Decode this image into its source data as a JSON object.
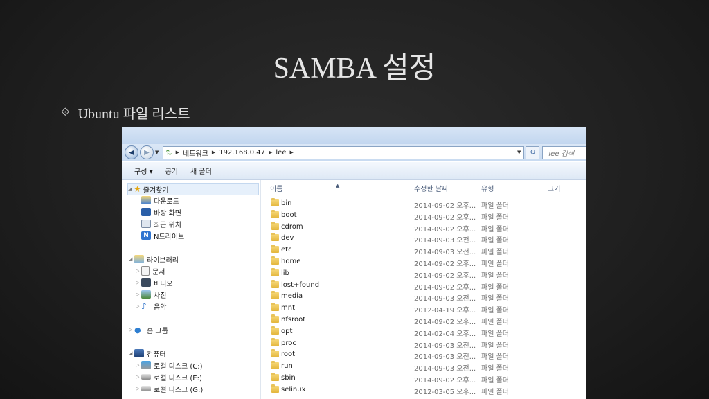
{
  "slide": {
    "title": "SAMBA 설정",
    "bullet_glyph": "⟐",
    "bullet_text": "Ubuntu 파일 리스트"
  },
  "explorer": {
    "address": {
      "crumbs": [
        "네트워크",
        "192.168.0.47",
        "lee"
      ],
      "search_placeholder": "lee 검색"
    },
    "toolbar": {
      "organize": "구성 ▾",
      "share": "공기",
      "new_folder": "새 폴더"
    },
    "nav_pane": {
      "favorites": {
        "label": "즐겨찾기",
        "items": [
          "다운로드",
          "바탕 화면",
          "최근 위치",
          "N드라이브"
        ]
      },
      "libraries": {
        "label": "라이브러리",
        "items": [
          "문서",
          "비디오",
          "사진",
          "음악"
        ]
      },
      "homegroup": "홈 그룹",
      "computer": {
        "label": "컴퓨터",
        "items": [
          "로컬 디스크 (C:)",
          "로컬 디스크 (E:)",
          "로컬 디스크 (G:)"
        ]
      }
    },
    "columns": {
      "name": "이름",
      "date": "수정한 날짜",
      "type": "유형",
      "size": "크기"
    },
    "files": [
      {
        "name": "bin",
        "date": "2014-09-02 오후...",
        "type": "파일 폴더"
      },
      {
        "name": "boot",
        "date": "2014-09-02 오후...",
        "type": "파일 폴더"
      },
      {
        "name": "cdrom",
        "date": "2014-09-02 오후...",
        "type": "파일 폴더"
      },
      {
        "name": "dev",
        "date": "2014-09-03 오전...",
        "type": "파일 폴더"
      },
      {
        "name": "etc",
        "date": "2014-09-03 오전...",
        "type": "파일 폴더"
      },
      {
        "name": "home",
        "date": "2014-09-02 오후...",
        "type": "파일 폴더"
      },
      {
        "name": "lib",
        "date": "2014-09-02 오후...",
        "type": "파일 폴더"
      },
      {
        "name": "lost+found",
        "date": "2014-09-02 오후...",
        "type": "파일 폴더"
      },
      {
        "name": "media",
        "date": "2014-09-03 오전...",
        "type": "파일 폴더"
      },
      {
        "name": "mnt",
        "date": "2012-04-19 오후...",
        "type": "파일 폴더"
      },
      {
        "name": "nfsroot",
        "date": "2014-09-02 오후...",
        "type": "파일 폴더"
      },
      {
        "name": "opt",
        "date": "2014-02-04 오후...",
        "type": "파일 폴더"
      },
      {
        "name": "proc",
        "date": "2014-09-03 오전...",
        "type": "파일 폴더"
      },
      {
        "name": "root",
        "date": "2014-09-03 오전...",
        "type": "파일 폴더"
      },
      {
        "name": "run",
        "date": "2014-09-03 오전...",
        "type": "파일 폴더"
      },
      {
        "name": "sbin",
        "date": "2014-09-02 오후...",
        "type": "파일 폴더"
      },
      {
        "name": "selinux",
        "date": "2012-03-05 오후...",
        "type": "파일 폴더"
      }
    ]
  }
}
